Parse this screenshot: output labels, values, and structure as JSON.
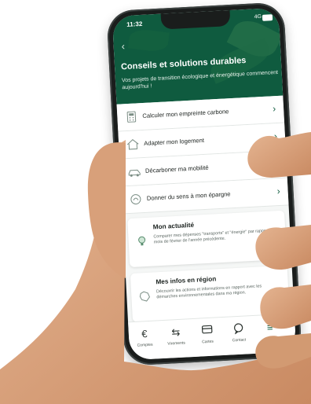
{
  "status": {
    "time": "11:32",
    "network": "4G"
  },
  "header": {
    "back_icon": "chevron-left-icon",
    "title": "Conseils et solutions durables",
    "subtitle": "Vos projets de transition écologique et énergétique commencent aujourd'hui !"
  },
  "list": [
    {
      "label": "Calculer mon empreinte carbone",
      "icon": "calculator-icon"
    },
    {
      "label": "Adapter mon logement",
      "icon": "house-icon"
    },
    {
      "label": "Décarboner ma mobilité",
      "icon": "car-icon"
    },
    {
      "label": "Donner du sens à mon épargne",
      "icon": "savings-icon"
    }
  ],
  "cards": [
    {
      "title": "Mon actualité",
      "body": "Comparer mes dépenses \"transports\" et \"énergie\" par rapport au mois de février de l'année précédente.",
      "icon": "lightbulb-icon"
    },
    {
      "title": "Mes infos en région",
      "body": "Découvrir les actions et informations en rapport avec les démarches environnementales dans ma région.",
      "icon": "region-map-icon"
    }
  ],
  "nav": [
    {
      "label": "Comptes",
      "icon": "euro-icon"
    },
    {
      "label": "Virements",
      "icon": "transfer-icon"
    },
    {
      "label": "Cartes",
      "icon": "card-icon"
    },
    {
      "label": "Contact",
      "icon": "chat-icon"
    },
    {
      "label": "Plus",
      "icon": "menu-icon"
    }
  ],
  "colors": {
    "primary": "#0f5b3f",
    "accent": "#2f7a4e",
    "skin": "#d9a27c"
  }
}
